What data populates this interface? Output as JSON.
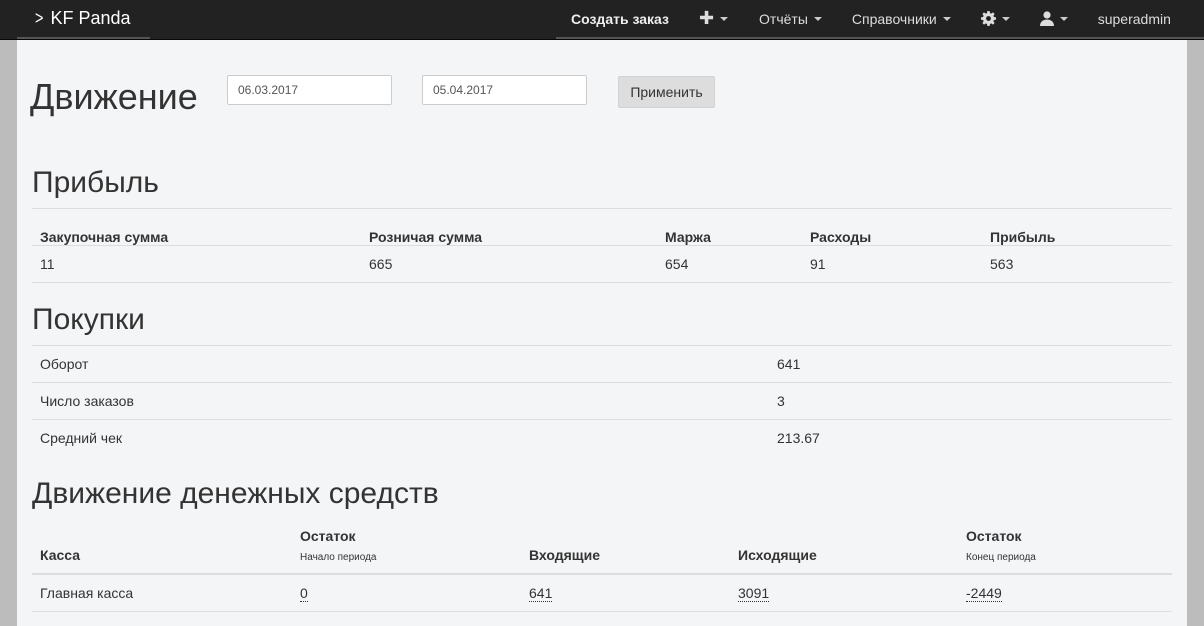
{
  "navbar": {
    "brand": "KF Panda",
    "create_order": "Создать заказ",
    "reports": "Отчёты",
    "directories": "Справочники",
    "username": "superadmin"
  },
  "page": {
    "title": "Движение",
    "date_from": "06.03.2017",
    "date_to": "05.04.2017",
    "apply_label": "Применить"
  },
  "profit": {
    "title": "Прибыль",
    "headers": [
      "Закупочная сумма",
      "Розничая сумма",
      "Маржа",
      "Расходы",
      "Прибыль"
    ],
    "values": [
      "11",
      "665",
      "654",
      "91",
      "563"
    ]
  },
  "purchases": {
    "title": "Покупки",
    "rows": [
      {
        "label": "Оборот",
        "value": "641"
      },
      {
        "label": "Число заказов",
        "value": "3"
      },
      {
        "label": "Средний чек",
        "value": "213.67"
      }
    ]
  },
  "cashflow": {
    "title": "Движение денежных средств",
    "headers": {
      "cashbox": "Касса",
      "start_balance": "Остаток",
      "start_sub": "Начало периода",
      "incoming": "Входящие",
      "outgoing": "Исходящие",
      "end_balance": "Остаток",
      "end_sub": "Конец периода"
    },
    "rows": [
      {
        "cashbox": "Главная касса",
        "start": "0",
        "incoming": "641",
        "outgoing": "3091",
        "end": "-2449"
      }
    ]
  }
}
